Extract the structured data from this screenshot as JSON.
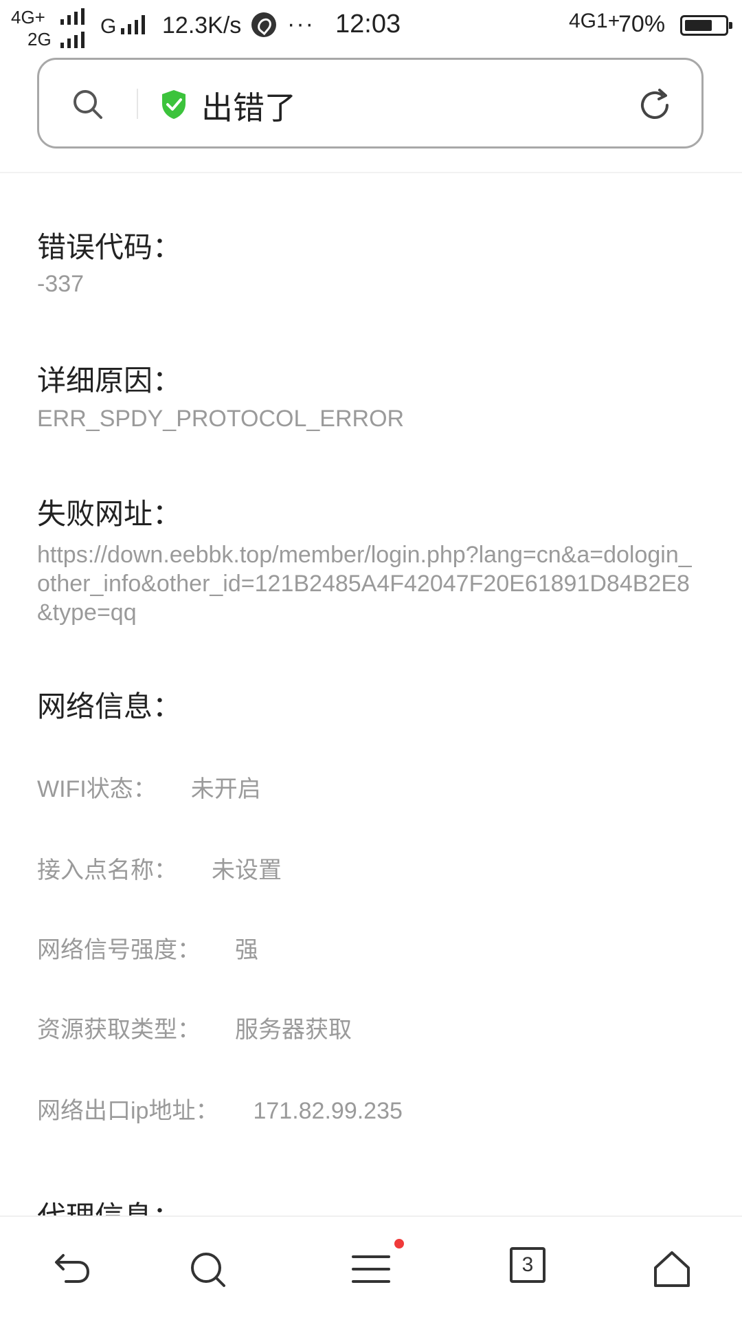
{
  "status_bar": {
    "net1": "4G+",
    "net2": "2G",
    "net3": "G",
    "speed": "12.3K/s",
    "more": "···",
    "time": "12:03",
    "right_net": "4G1+",
    "battery": "70%",
    "battery_level": 0.7
  },
  "address_bar": {
    "title": "出错了"
  },
  "error": {
    "code_label": "错误代码：",
    "code_value": "-337",
    "reason_label": "详细原因：",
    "reason_value": "ERR_SPDY_PROTOCOL_ERROR",
    "url_label": "失败网址：",
    "url_value": "https://down.eebbk.top/member/login.php?lang=cn&a=dologin_other_info&other_id=121B2485A4F42047F20E61891D84B2E8&type=qq",
    "network_label": "网络信息：",
    "network_rows": [
      {
        "label": "WIFI状态：",
        "value": "未开启"
      },
      {
        "label": "接入点名称：",
        "value": "未设置"
      },
      {
        "label": "网络信号强度：",
        "value": "强"
      },
      {
        "label": "资源获取类型：",
        "value": "服务器获取"
      },
      {
        "label": "网络出口ip地址：",
        "value": "171.82.99.235"
      }
    ],
    "proxy_label": "代理信息："
  },
  "bottom_nav": {
    "tab_count": "3"
  },
  "colors": {
    "shield": "#3cc33c",
    "badge": "#f03a3a",
    "muted_text": "#9a9a9a"
  }
}
